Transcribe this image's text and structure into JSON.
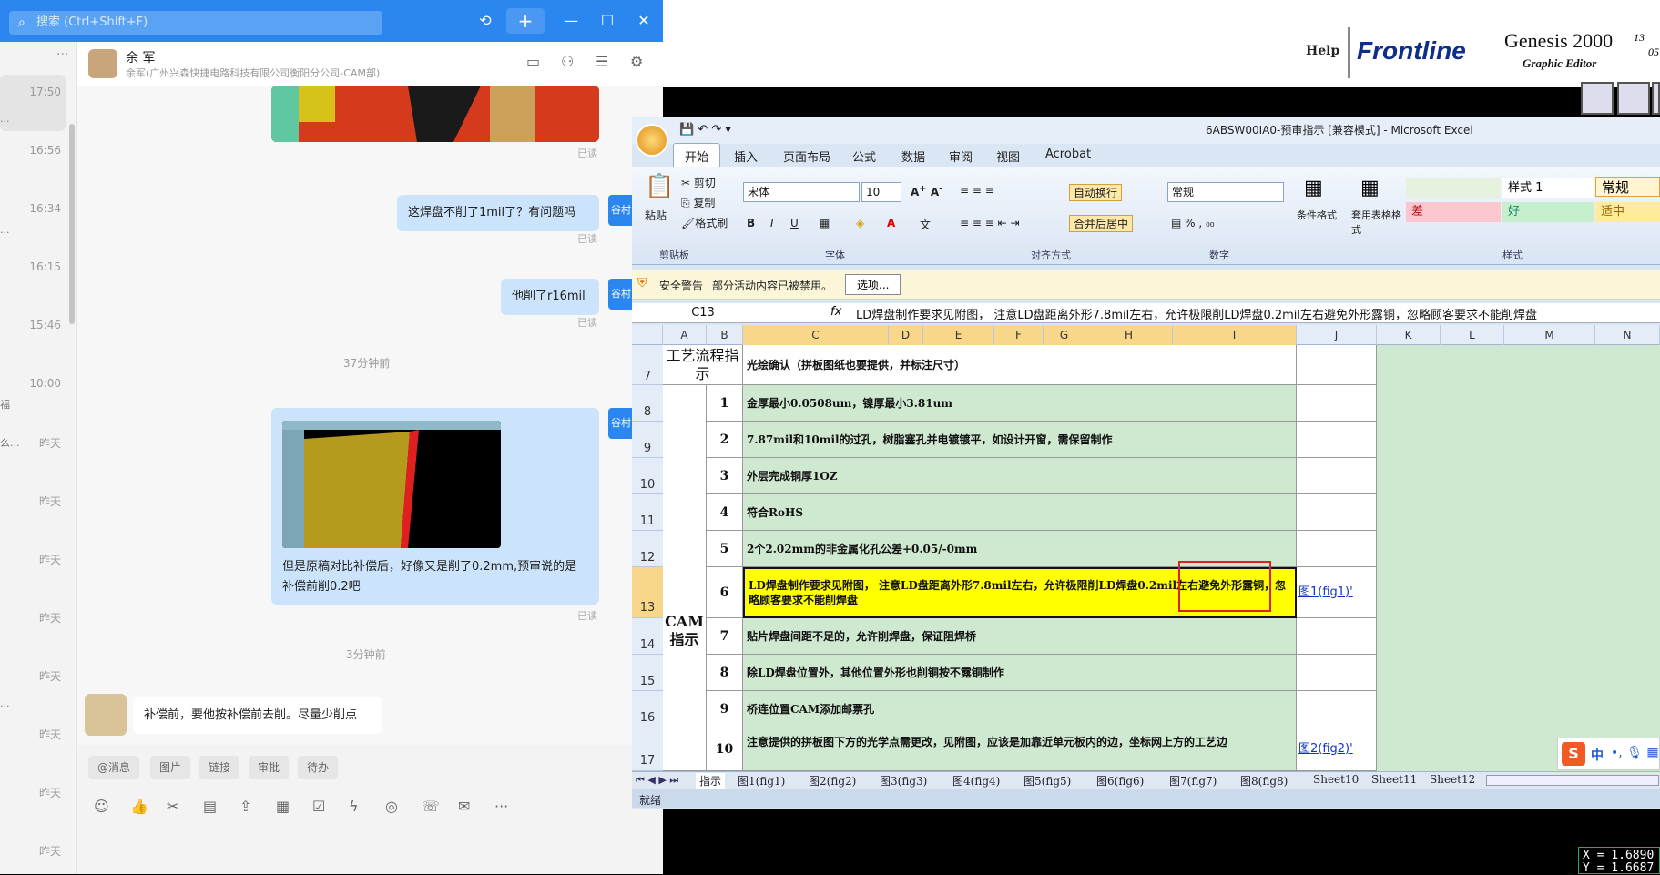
{
  "chat": {
    "search_placeholder": "搜索 (Ctrl+Shift+F)",
    "conv_times": [
      "17:50",
      "16:56",
      "16:34",
      "16:15",
      "15:46",
      "10:00",
      "昨天",
      "昨天",
      "昨天",
      "昨天",
      "昨天",
      "昨天",
      "昨天",
      "昨天"
    ],
    "conv_snippets": [
      "...",
      "...",
      "福",
      "么...",
      "..."
    ],
    "contact_name": "余 军",
    "contact_sub": "余军(广州兴森快捷电路科技有限公司衡阳分公司-CAM部)",
    "side_label": "谷村",
    "read": "已读",
    "messages": {
      "m1": "这焊盘不削了1mil了？有问题吗",
      "m2": "他削了r16mil",
      "t1": "37分钟前",
      "m3": "但是原稿对比补偿后，好像又是削了0.2mm,预审说的是补偿前削0.2吧",
      "t2": "3分钟前",
      "m4": "补偿前，要他按补偿前去削。尽量少削点"
    },
    "quick": [
      "@消息",
      "图片",
      "链接",
      "审批",
      "待办"
    ]
  },
  "genesis": {
    "help": "Help",
    "brand": "Frontline",
    "product": "Genesis 2000",
    "subtitle": "Graphic Editor",
    "version_top": "13",
    "version_bot": "05",
    "coord_x": "X = 1.6890",
    "coord_y": "Y = 1.6687"
  },
  "excel": {
    "title": "6ABSW00IA0-预审指示 [兼容模式] - Microsoft Excel",
    "menus": [
      "开始",
      "插入",
      "页面布局",
      "公式",
      "数据",
      "审阅",
      "视图",
      "Acrobat"
    ],
    "ribbon": {
      "paste": "粘贴",
      "cut": "剪切",
      "copy": "复制",
      "format_painter": "格式刷",
      "font": "宋体",
      "size": "10",
      "wrap": "自动换行",
      "merge": "合并后居中",
      "number_format": "常规",
      "cond_format": "条件格式",
      "table_format": "套用表格格式",
      "style1": "样式 1",
      "style_normal": "常规",
      "style_bad": "差",
      "style_good": "好",
      "style_neutral": "适中",
      "groups": [
        "剪贴板",
        "字体",
        "对齐方式",
        "数字",
        "样式"
      ]
    },
    "security": {
      "label": "安全警告",
      "msg": "部分活动内容已被禁用。",
      "btn": "选项..."
    },
    "namebox": "C13",
    "fx": "fx",
    "formula": "LD焊盘制作要求见附图，  注意LD盘距离外形7.8mil左右，允许极限削LD焊盘0.2mil左右避免外形露铜，忽略顾客要求不能削焊盘",
    "columns": [
      "A",
      "B",
      "C",
      "D",
      "E",
      "F",
      "G",
      "H",
      "I",
      "J",
      "K",
      "L",
      "M",
      "N"
    ],
    "section1": "工艺流程指示",
    "row7": "光绘确认（拼板图纸也要提供，并标注尺寸）",
    "section2": "CAM指示",
    "rows": [
      {
        "r": "8",
        "n": "1",
        "t": "金厚最小0.0508um，镍厚最小3.81um",
        "link": ""
      },
      {
        "r": "9",
        "n": "2",
        "t": "7.87mil和10mil的过孔，树脂塞孔并电镀镀平，如设计开窗，需保留制作",
        "link": ""
      },
      {
        "r": "10",
        "n": "3",
        "t": "外层完成铜厚1OZ",
        "link": ""
      },
      {
        "r": "11",
        "n": "4",
        "t": "符合RoHS",
        "link": ""
      },
      {
        "r": "12",
        "n": "5",
        "t": "2个2.02mm的非金属化孔公差+0.05/-0mm",
        "link": ""
      },
      {
        "r": "13",
        "n": "6",
        "t": "LD焊盘制作要求见附图， 注意LD盘距离外形7.8mil左右，允许极限削LD焊盘0.2mil左右避免外形露铜，忽略顾客要求不能削焊盘",
        "link": "图1(fig1)'"
      },
      {
        "r": "14",
        "n": "7",
        "t": "贴片焊盘间距不足的，允许削焊盘，保证阻焊桥",
        "link": ""
      },
      {
        "r": "15",
        "n": "8",
        "t": "除LD焊盘位置外，其他位置外形也削铜按不露铜制作",
        "link": ""
      },
      {
        "r": "16",
        "n": "9",
        "t": "桥连位置CAM添加邮票孔",
        "link": ""
      },
      {
        "r": "17",
        "n": "10",
        "t": "注意提供的拼板图下方的光学点需更改，见附图，应该是加靠近单元板内的边，坐标网上方的工艺边",
        "link": "图2(fig2)'"
      }
    ],
    "sheets": [
      "指示",
      "图1(fig1)",
      "图2(fig2)",
      "图3(fig3)",
      "图4(fig4)",
      "图5(fig5)",
      "图6(fig6)",
      "图7(fig7)",
      "图8(fig8)",
      "Sheet10",
      "Sheet11",
      "Sheet12"
    ],
    "status": "就绪",
    "ime": "中"
  }
}
